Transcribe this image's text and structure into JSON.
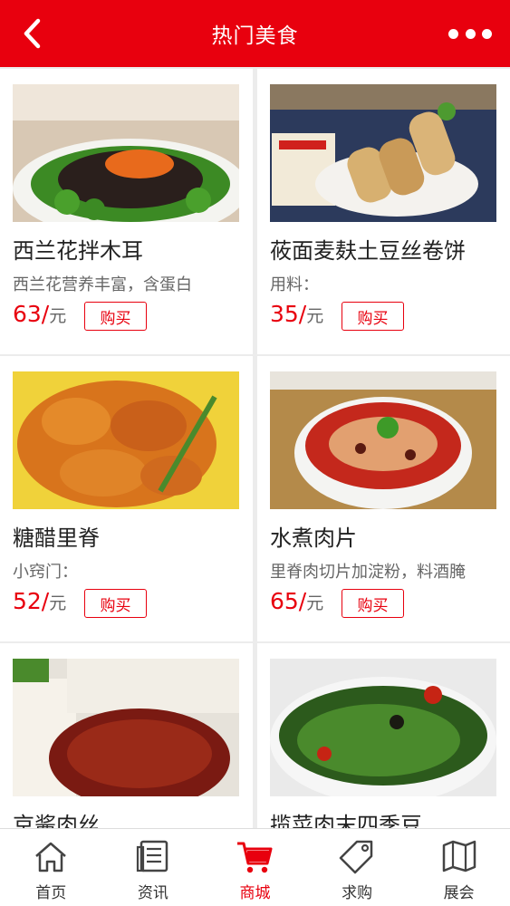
{
  "header": {
    "title": "热门美食"
  },
  "products": [
    {
      "name": "西兰花拌木耳",
      "desc": "西兰花营养丰富，含蛋白",
      "price": "63/",
      "unit": "元",
      "buy": "购买"
    },
    {
      "name": "莜面麦麸土豆丝卷饼",
      "desc": "用料：",
      "price": "35/",
      "unit": "元",
      "buy": "购买"
    },
    {
      "name": "糖醋里脊",
      "desc": "小窍门：",
      "price": "52/",
      "unit": "元",
      "buy": "购买"
    },
    {
      "name": "水煮肉片",
      "desc": "里脊肉切片加淀粉，料酒腌",
      "price": "65/",
      "unit": "元",
      "buy": "购买"
    },
    {
      "name": "京酱肉丝",
      "desc": "",
      "price": "",
      "unit": "",
      "buy": ""
    },
    {
      "name": "揽菜肉末四季豆",
      "desc": "",
      "price": "",
      "unit": "",
      "buy": ""
    }
  ],
  "tabs": [
    {
      "label": "首页",
      "icon": "home-icon"
    },
    {
      "label": "资讯",
      "icon": "news-icon"
    },
    {
      "label": "商城",
      "icon": "cart-icon",
      "active": true
    },
    {
      "label": "求购",
      "icon": "tag-icon"
    },
    {
      "label": "展会",
      "icon": "map-icon"
    }
  ],
  "colors": {
    "accent": "#e8000e",
    "background": "#ececec"
  }
}
